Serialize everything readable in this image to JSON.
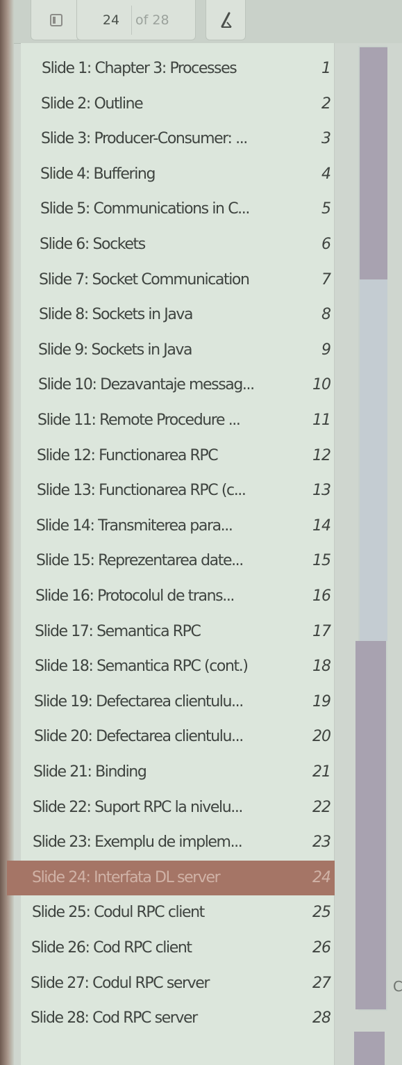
{
  "toolbar": {
    "view_icon": "slide-view-icon",
    "current_page": "24",
    "total_pages": "of 28",
    "edit_icon": "pencil-icon"
  },
  "slides": [
    {
      "title": "Slide 1: Chapter 3:  Processes",
      "num": "1"
    },
    {
      "title": "Slide 2: Outline",
      "num": "2"
    },
    {
      "title": "Slide 3: Producer-Consumer: ...",
      "num": "3"
    },
    {
      "title": "Slide 4: Buffering",
      "num": "4"
    },
    {
      "title": "Slide 5: Communications in C...",
      "num": "5"
    },
    {
      "title": "Slide 6: Sockets",
      "num": "6"
    },
    {
      "title": "Slide 7: Socket Communication",
      "num": "7"
    },
    {
      "title": "Slide 8: Sockets in Java",
      "num": "8"
    },
    {
      "title": "Slide 9: Sockets in Java",
      "num": "9"
    },
    {
      "title": "Slide 10: Dezavantaje messag...",
      "num": "10"
    },
    {
      "title": "Slide 11: Remote Procedure ...",
      "num": "11"
    },
    {
      "title": "Slide 12: Functionarea RPC",
      "num": "12"
    },
    {
      "title": "Slide 13: Functionarea RPC (c...",
      "num": "13"
    },
    {
      "title": "Slide 14: Transmiterea para...",
      "num": "14"
    },
    {
      "title": "Slide 15: Reprezentarea date...",
      "num": "15"
    },
    {
      "title": "Slide 16: Protocolul de trans...",
      "num": "16"
    },
    {
      "title": "Slide 17: Semantica RPC",
      "num": "17"
    },
    {
      "title": "Slide 18: Semantica RPC (cont.)",
      "num": "18"
    },
    {
      "title": "Slide 19: Defectarea clientulu...",
      "num": "19"
    },
    {
      "title": "Slide 20: Defectarea clientulu...",
      "num": "20"
    },
    {
      "title": "Slide 21: Binding",
      "num": "21"
    },
    {
      "title": "Slide 22: Suport RPC la nivelu...",
      "num": "22"
    },
    {
      "title": "Slide 23: Exemplu de implem...",
      "num": "23"
    },
    {
      "title": "Slide 24: Interfata DL server",
      "num": "24"
    },
    {
      "title": "Slide 25: Codul RPC client",
      "num": "25"
    },
    {
      "title": "Slide 26: Cod RPC client",
      "num": "26"
    },
    {
      "title": "Slide 27: Codul RPC server",
      "num": "27"
    },
    {
      "title": "Slide 28: Cod RPC server",
      "num": "28"
    }
  ],
  "selected_slide": "24",
  "edge_text": "C",
  "colors": {
    "panel": "#dce6dc",
    "selection": "#a57566",
    "scroll_thumb": "#a8a2b0"
  }
}
